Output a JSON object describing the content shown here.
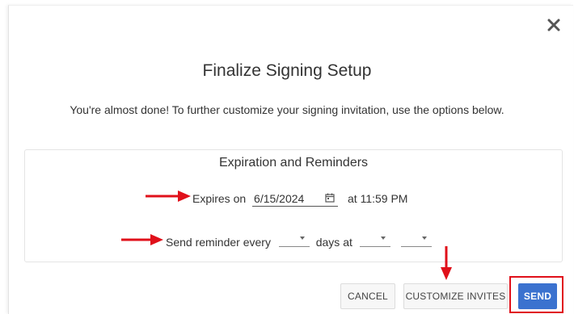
{
  "dialog": {
    "title": "Finalize Signing Setup",
    "subtitle": "You're almost done! To further customize your signing invitation, use the options below."
  },
  "expiration": {
    "section_title": "Expiration and Reminders",
    "expires_label": "Expires on",
    "expires_date": "6/15/2024",
    "expires_time_label": "at 11:59 PM",
    "reminder_label": "Send reminder every",
    "reminder_interval": "",
    "reminder_days_label": "days at",
    "reminder_hour": "",
    "reminder_minute": ""
  },
  "buttons": {
    "cancel": "CANCEL",
    "customize": "CUSTOMIZE INVITES",
    "send": "SEND"
  },
  "icons": {
    "close": "close-icon",
    "calendar": "calendar-icon"
  },
  "colors": {
    "primary": "#3b72cf",
    "annotation": "#e0101a"
  }
}
